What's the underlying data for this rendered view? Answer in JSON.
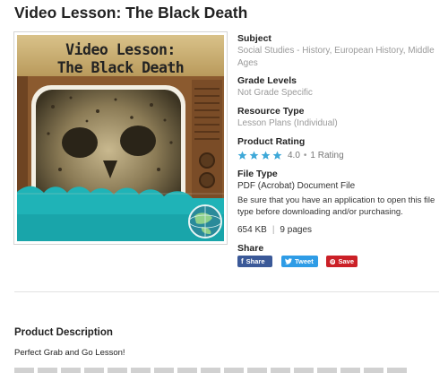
{
  "product": {
    "title": "Video Lesson: The Black Death",
    "thumbnail": {
      "line1": "Video Lesson:",
      "line2": "The Black Death",
      "icon": "globe-icon"
    }
  },
  "details": {
    "subject_label": "Subject",
    "subject_value": "Social Studies - History, European History, Middle Ages",
    "grade_label": "Grade Levels",
    "grade_value": "Not Grade Specific",
    "resource_label": "Resource Type",
    "resource_value": "Lesson Plans (Individual)",
    "rating_label": "Product Rating",
    "rating_value": "4.0",
    "rating_stars": 4,
    "rating_count": "1 Rating",
    "filetype_label": "File Type",
    "filetype_value": "PDF (Acrobat) Document File",
    "filetype_note": "Be sure that you have an application to open this file type before downloading and/or purchasing.",
    "file_size": "654 KB",
    "pages": "9 pages",
    "share_label": "Share"
  },
  "share": {
    "facebook": "Share",
    "twitter": "Tweet",
    "pinterest": "Save"
  },
  "description": {
    "title": "Product Description",
    "text": "Perfect Grab and Go Lesson!"
  },
  "colors": {
    "star": "#3da8d8",
    "facebook": "#3b5998",
    "twitter": "#2e9ce6",
    "pinterest": "#cb2027"
  }
}
